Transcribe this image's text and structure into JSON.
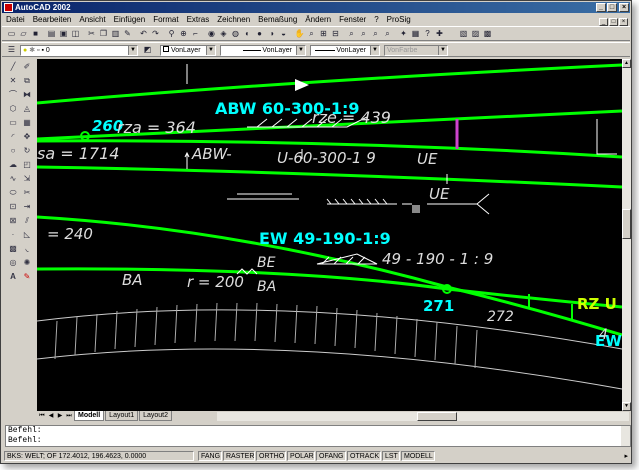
{
  "window": {
    "title": "AutoCAD 2002"
  },
  "menu": [
    "Datei",
    "Bearbeiten",
    "Ansicht",
    "Einfügen",
    "Format",
    "Extras",
    "Zeichnen",
    "Bemaßung",
    "Ändern",
    "Fenster",
    "?",
    "ProSig"
  ],
  "properties": {
    "layer": "0",
    "color": "VonLayer",
    "linetype": "VonLayer",
    "lineweight": "VonLayer",
    "plotstyle": "VonFarbe"
  },
  "drawing": {
    "labels_cyan": [
      "ABW 60-300-1:9",
      "260",
      "EW 49-190-1:9",
      "271",
      "EW"
    ],
    "labels_white": [
      "rza = 364",
      "rze = 439",
      "sa = 1714",
      "ABW-",
      "U-60-300-1 9",
      "UE",
      "UE",
      "= 240",
      "49 - 190 - 1 : 9",
      "BE",
      "BA",
      "BA",
      "r = 200",
      "272",
      "4"
    ],
    "labels_yellow": [
      "RZ U"
    ]
  },
  "tabs": [
    "Modell",
    "Layout1",
    "Layout2"
  ],
  "command_lines": [
    "Befehl:",
    "Befehl:"
  ],
  "status": {
    "prefix": "BKS: WELT; OF",
    "coords": "172.4012, 196.4623, 0.0000",
    "modes": [
      "FANG",
      "RASTER",
      "ORTHO",
      "POLAR",
      "OFANG",
      "OTRACK",
      "LST",
      "MODELL"
    ]
  },
  "colors": {
    "track_green": "#00ff00",
    "label_cyan": "#00ffff",
    "label_yellow": "#ccff00",
    "marker_magenta": "#cc44cc"
  }
}
